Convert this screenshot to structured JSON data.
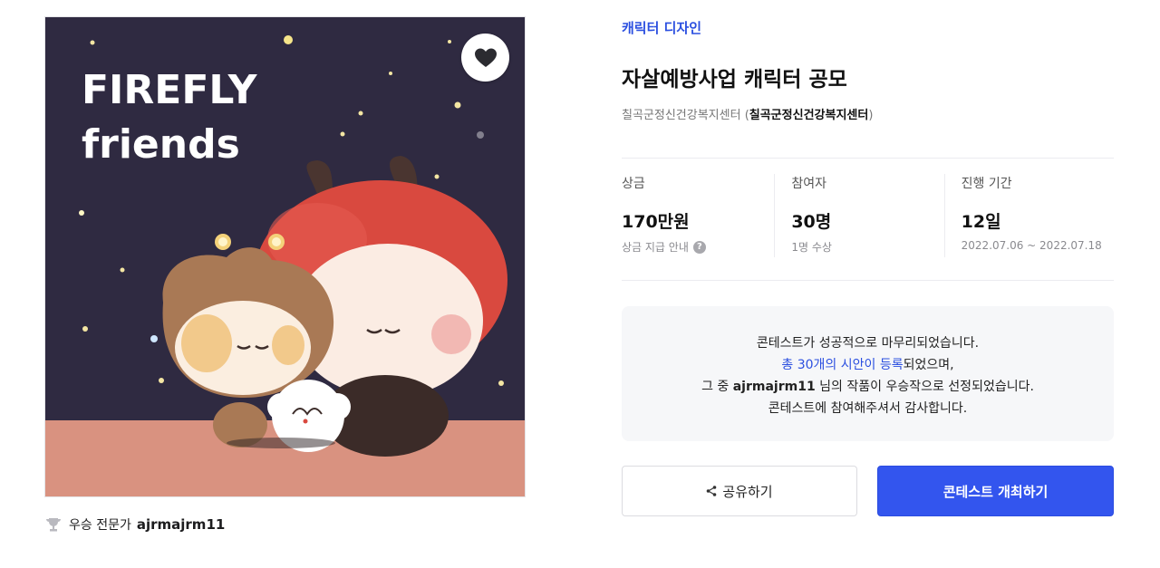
{
  "artwork": {
    "logo_line1": "FIREFLY",
    "logo_line2": "friends"
  },
  "favorite_icon": "heart-icon",
  "winner": {
    "icon": "trophy-icon",
    "label": "우승 전문가",
    "name": "ajrmajrm11"
  },
  "contest": {
    "category": "캐릭터 디자인",
    "title": "자살예방사업 캐릭터 공모",
    "org_prefix": "칠곡군정신건강복지센터 (",
    "org_name": "칠곡군정신건강복지센터",
    "org_suffix": ")"
  },
  "stats": [
    {
      "caption": "상금",
      "value": "170만원",
      "sub": "상금 지급 안내",
      "sub_icon": "help-icon"
    },
    {
      "caption": "참여자",
      "value": "30명",
      "sub": "1명 수상"
    },
    {
      "caption": "진행 기간",
      "value": "12일",
      "sub": "2022.07.06 ~ 2022.07.18"
    }
  ],
  "notice": {
    "line1": "콘테스트가 성공적으로 마무리되었습니다.",
    "line2_link": "총 30개의 시안이 등록",
    "line2_rest": "되었으며,",
    "line3_pre": "그 중 ",
    "line3_name": "ajrmajrm11",
    "line3_post": " 님의 작품이 우승작으로 선정되었습니다.",
    "line4": "콘테스트에 참여해주셔서 감사합니다."
  },
  "buttons": {
    "share_label": "공유하기",
    "share_icon": "share-icon",
    "host_label": "콘테스트 개최하기"
  },
  "colors": {
    "accent": "#2b4fe0",
    "primary_button": "#3355ee",
    "artwork_bg": "#2f2a41",
    "artwork_floor": "#d99280"
  }
}
